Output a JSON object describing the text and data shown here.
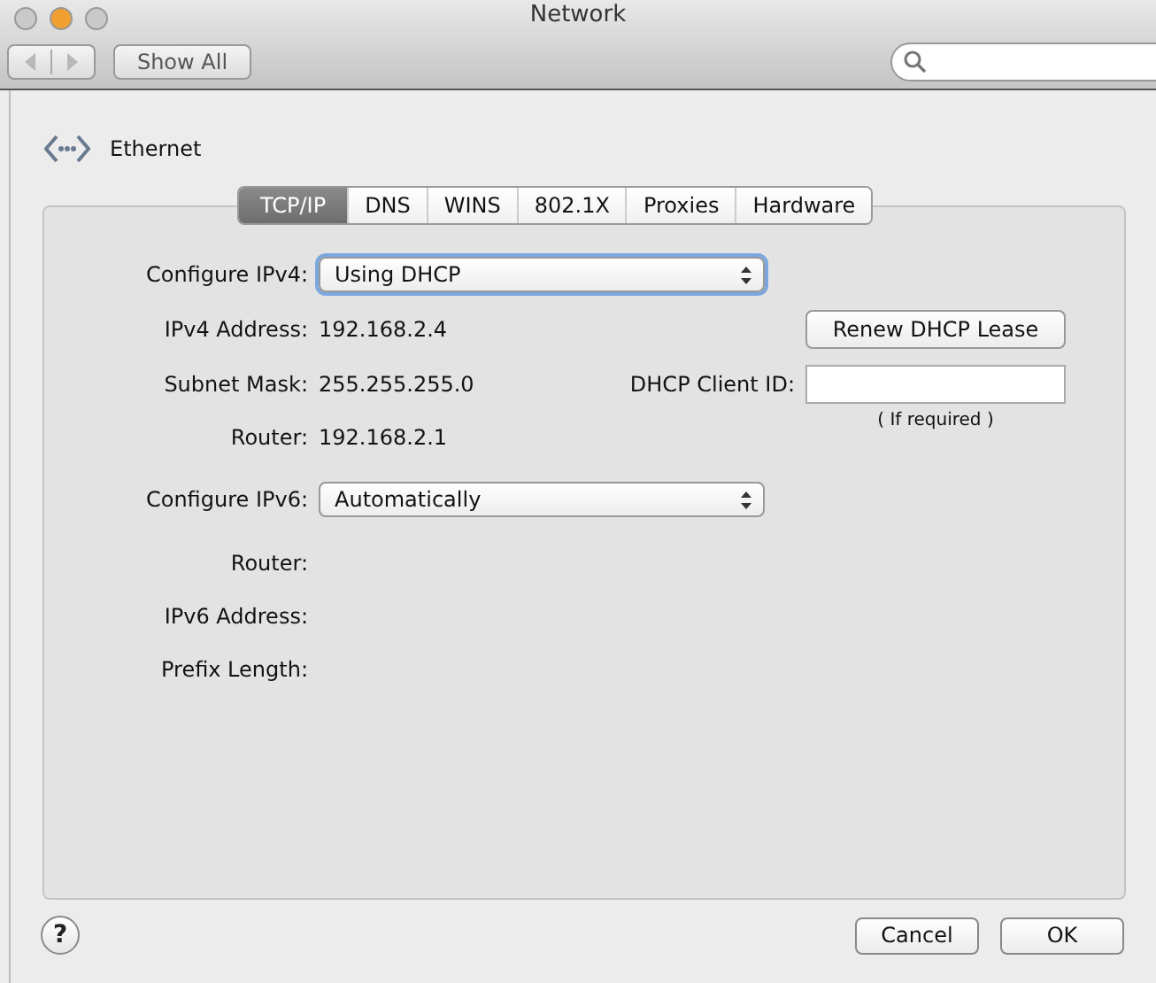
{
  "window": {
    "title": "Network",
    "traffic_lights": [
      {
        "color": "#c9c9c9"
      },
      {
        "color": "#f0a030"
      },
      {
        "color": "#c9c9c9"
      }
    ]
  },
  "toolbar": {
    "show_all": "Show All"
  },
  "service": {
    "name": "Ethernet"
  },
  "tabs": [
    {
      "label": "TCP/IP",
      "selected": true
    },
    {
      "label": "DNS",
      "selected": false
    },
    {
      "label": "WINS",
      "selected": false
    },
    {
      "label": "802.1X",
      "selected": false
    },
    {
      "label": "Proxies",
      "selected": false
    },
    {
      "label": "Hardware",
      "selected": false
    }
  ],
  "ipv4": {
    "configure_label": "Configure IPv4:",
    "configure_value": "Using DHCP",
    "focused": true,
    "fields": [
      {
        "label": "IPv4 Address:",
        "value": "192.168.2.4"
      },
      {
        "label": "Subnet Mask:",
        "value": "255.255.255.0"
      },
      {
        "label": "Router:",
        "value": "192.168.2.1"
      }
    ]
  },
  "renew_button": "Renew DHCP Lease",
  "client_id": {
    "label": "DHCP Client ID:",
    "hint": "( If required )"
  },
  "ipv6": {
    "configure_label": "Configure IPv6:",
    "configure_value": "Automatically",
    "focused": false,
    "fields": [
      {
        "label": "Router:"
      },
      {
        "label": "IPv6 Address:"
      },
      {
        "label": "Prefix Length:"
      }
    ]
  },
  "help_button": "?",
  "buttons": [
    "Cancel",
    "OK"
  ]
}
